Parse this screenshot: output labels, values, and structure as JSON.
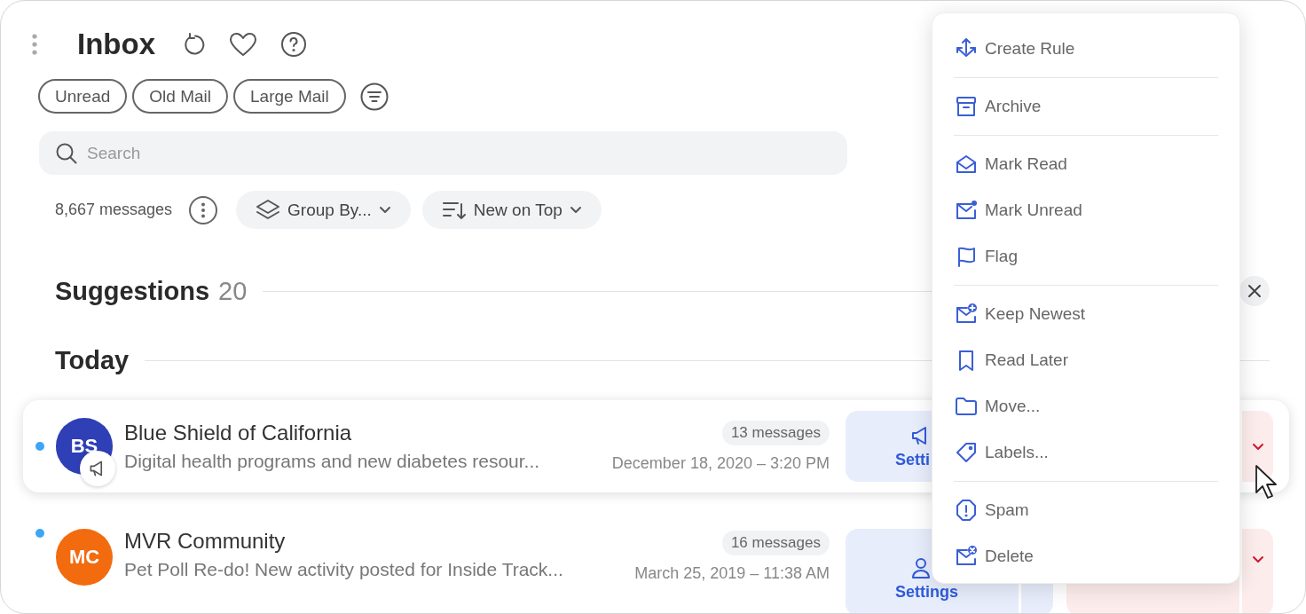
{
  "title": "Inbox",
  "filters": [
    "Unread",
    "Old Mail",
    "Large Mail"
  ],
  "search": {
    "placeholder": "Search"
  },
  "message_count": "8,667 messages",
  "group_by": "Group By...",
  "sort": "New on Top",
  "suggestions": {
    "title": "Suggestions",
    "count": "20"
  },
  "today": "Today",
  "rows": [
    {
      "initials": "BS",
      "color": "#2f3fb5",
      "sender": "Blue Shield of California",
      "preview": "Digital health programs and new diabetes resour...",
      "messages": "13 messages",
      "date": "December 18, 2020 – 3:20 PM",
      "unread": true,
      "badge": true,
      "highlighted": true,
      "action": "Setti"
    },
    {
      "initials": "MC",
      "color": "#f26b0f",
      "sender": "MVR Community",
      "preview": "Pet Poll Re-do! New activity posted for Inside Track...",
      "messages": "16 messages",
      "date": "March 25, 2019 – 11:38 AM",
      "unread": true,
      "badge": false,
      "highlighted": false,
      "action": "Settings"
    }
  ],
  "menu": [
    [
      "Create Rule"
    ],
    [
      "Archive"
    ],
    [
      "Mark Read",
      "Mark Unread",
      "Flag"
    ],
    [
      "Keep Newest",
      "Read Later",
      "Move...",
      "Labels..."
    ],
    [
      "Spam",
      "Delete"
    ]
  ]
}
